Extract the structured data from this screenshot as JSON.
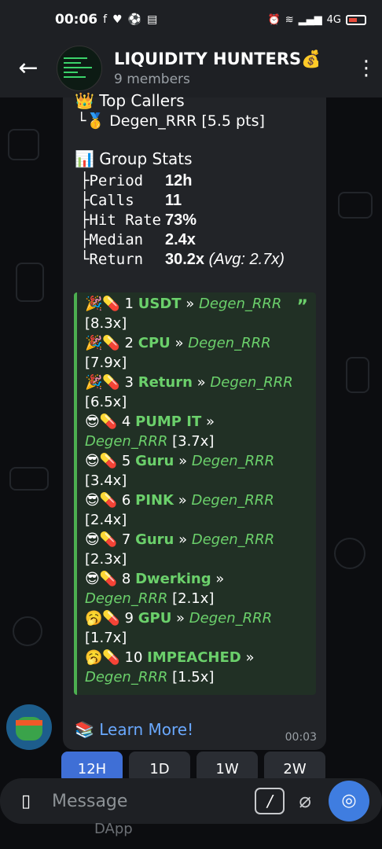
{
  "status": {
    "time": "00:06",
    "signal": "4G"
  },
  "header": {
    "title": "LIQUIDITY HUNTERS💰.",
    "subtitle": "9 members"
  },
  "message": {
    "callers_title": "👑 Top Callers",
    "callers_row": "└🥇 Degen_RRR [5.5 pts]",
    "stats_title": "📊 Group Stats",
    "stats": [
      {
        "k": "├Period",
        "v": "12h",
        "extra": ""
      },
      {
        "k": "├Calls",
        "v": "11",
        "extra": ""
      },
      {
        "k": "├Hit Rate",
        "v": "73%",
        "extra": ""
      },
      {
        "k": "├Median",
        "v": "2.4x",
        "extra": ""
      },
      {
        "k": "└Return",
        "v": "30.2x",
        "extra": " (Avg: 2.7x)"
      }
    ],
    "calls": [
      {
        "pre": "🎉💊 1 ",
        "name": "USDT",
        "by": "Degen_RRR",
        "mult": "[8.3x]",
        "wrap": true
      },
      {
        "pre": "🎉💊 2 ",
        "name": "CPU",
        "by": "Degen_RRR",
        "mult": "[7.9x]",
        "wrap": true
      },
      {
        "pre": "🎉💊 3 ",
        "name": "Return",
        "by": "Degen_RRR",
        "mult": "[6.5x]",
        "wrap": true
      },
      {
        "pre": "😎💊 4 ",
        "name": "PUMP IT",
        "by": "Degen_RRR",
        "mult": "[3.7x]",
        "wrap": false
      },
      {
        "pre": "😎💊 5 ",
        "name": "Guru",
        "by": "Degen_RRR",
        "mult": "[3.4x]",
        "wrap": true
      },
      {
        "pre": "😎💊 6 ",
        "name": "PINK",
        "by": "Degen_RRR",
        "mult": "[2.4x]",
        "wrap": true
      },
      {
        "pre": "😎💊 7 ",
        "name": "Guru",
        "by": "Degen_RRR",
        "mult": "[2.3x]",
        "wrap": true
      },
      {
        "pre": "😎💊 8 ",
        "name": "Dwerking",
        "by": "Degen_RRR",
        "mult": "[2.1x]",
        "wrap": false
      },
      {
        "pre": "🥱💊 9 ",
        "name": "GPU",
        "by": "Degen_RRR",
        "mult": "[1.7x]",
        "wrap": true
      },
      {
        "pre": "🥱💊 10 ",
        "name": "IMPEACHED",
        "by": "Degen_RRR",
        "mult": "[1.5x]",
        "wrap": false
      }
    ],
    "learn_more": "📚 Learn More!",
    "time": "00:03"
  },
  "keyboard": [
    "12H",
    "1D",
    "1W",
    "2W"
  ],
  "input": {
    "placeholder": "Message"
  },
  "bottom": {
    "dapp": "DApp"
  }
}
